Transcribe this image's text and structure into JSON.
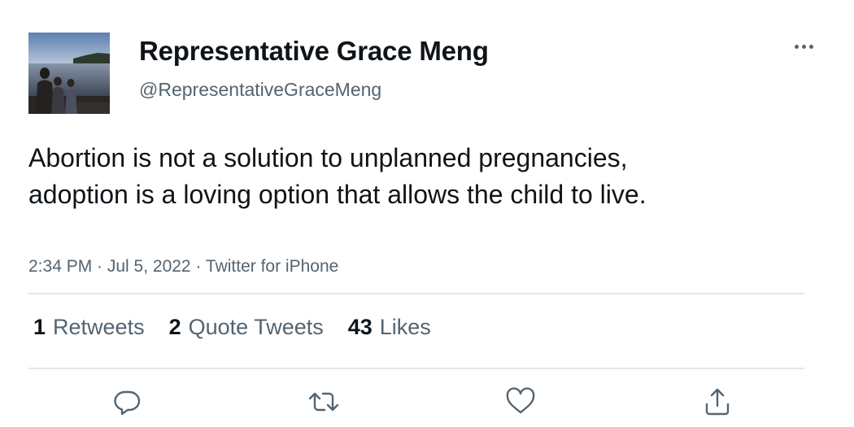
{
  "author": {
    "display_name": "Representative Grace Meng",
    "handle": "@RepresentativeGraceMeng",
    "avatar_icon": "profile-photo-lake-family"
  },
  "tweet": {
    "text": "Abortion is not a solution to unplanned pregnancies, adoption is a loving option that allows the child to live.",
    "meta": "2:34 PM · Jul 5, 2022 · Twitter for iPhone"
  },
  "stats": [
    {
      "count": "1",
      "label": "Retweets"
    },
    {
      "count": "2",
      "label": "Quote Tweets"
    },
    {
      "count": "43",
      "label": "Likes"
    }
  ],
  "actions": {
    "reply_icon": "reply-icon",
    "retweet_icon": "retweet-icon",
    "like_icon": "heart-icon",
    "share_icon": "share-icon"
  },
  "colors": {
    "text_primary": "#0f1419",
    "text_secondary": "#536471",
    "divider": "#e3e6e9"
  }
}
